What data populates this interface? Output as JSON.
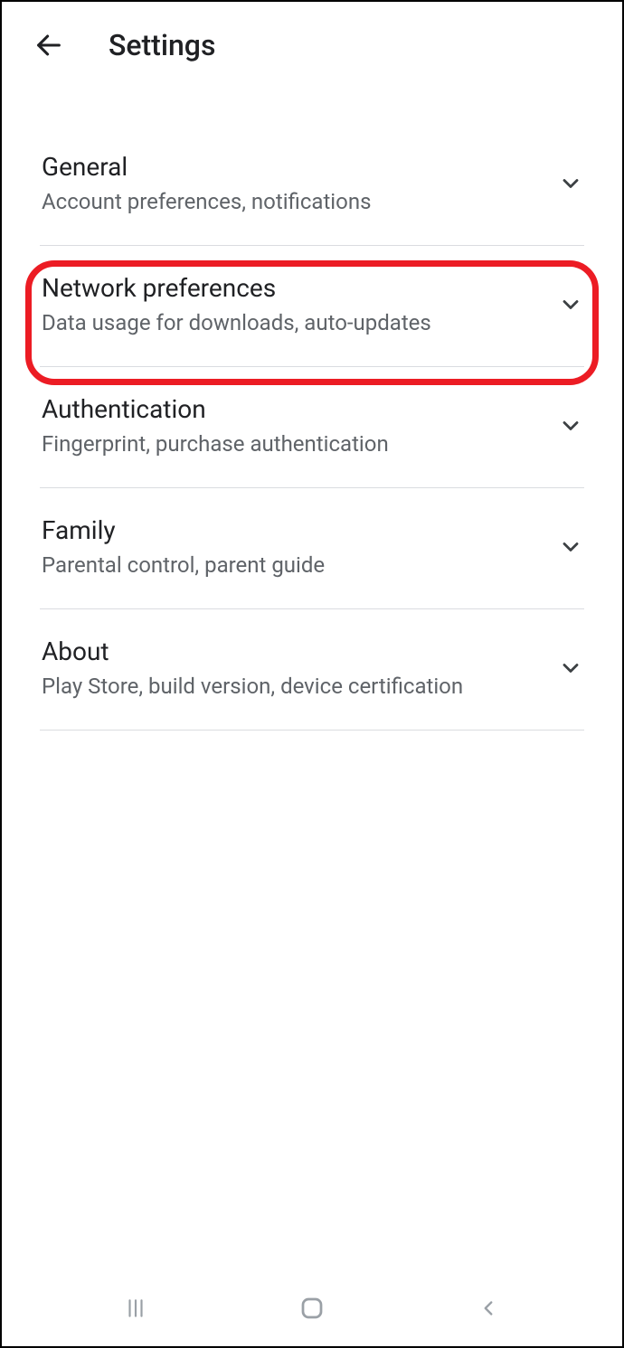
{
  "header": {
    "title": "Settings"
  },
  "items": [
    {
      "title": "General",
      "subtitle": "Account preferences, notifications"
    },
    {
      "title": "Network preferences",
      "subtitle": "Data usage for downloads, auto-updates"
    },
    {
      "title": "Authentication",
      "subtitle": "Fingerprint, purchase authentication"
    },
    {
      "title": "Family",
      "subtitle": "Parental control, parent guide"
    },
    {
      "title": "About",
      "subtitle": "Play Store, build version, device certification"
    }
  ]
}
